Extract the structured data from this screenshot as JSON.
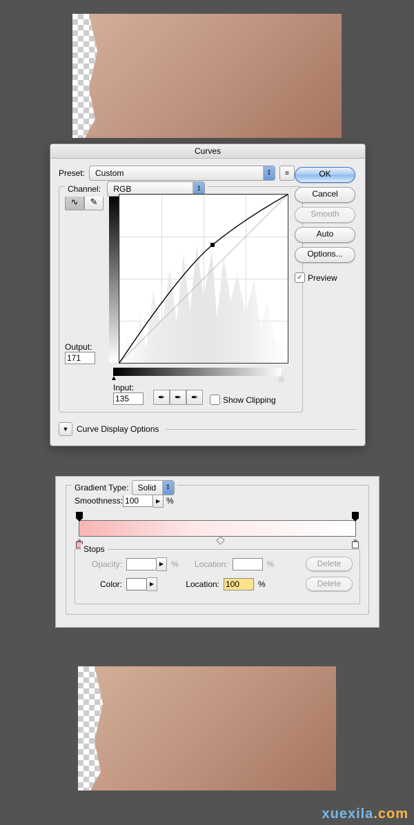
{
  "curves": {
    "title": "Curves",
    "preset_label": "Preset:",
    "preset_value": "Custom",
    "channel_label": "Channel:",
    "channel_value": "RGB",
    "output_label": "Output:",
    "output_value": "171",
    "input_label": "Input:",
    "input_value": "135",
    "show_clipping": "Show Clipping",
    "curve_display_options": "Curve Display Options",
    "buttons": {
      "ok": "OK",
      "cancel": "Cancel",
      "smooth": "Smooth",
      "auto": "Auto",
      "options": "Options..."
    },
    "preview": "Preview"
  },
  "gradient": {
    "type_label": "Gradient Type:",
    "type_value": "Solid",
    "smoothness_label": "Smoothness:",
    "smoothness_value": "100",
    "smoothness_unit": "%",
    "stops_label": "Stops",
    "opacity_label": "Opacity:",
    "opacity_value": "",
    "opacity_unit": "%",
    "opacity_location_label": "Location:",
    "opacity_location_value": "",
    "opacity_location_unit": "%",
    "color_label": "Color:",
    "color_location_label": "Location:",
    "color_location_value": "100",
    "color_location_unit": "%",
    "delete_label": "Delete",
    "start_color": "#f9b4b4",
    "end_color": "#ffffff"
  },
  "watermark": {
    "a": "xuexila",
    "b": ".com"
  }
}
